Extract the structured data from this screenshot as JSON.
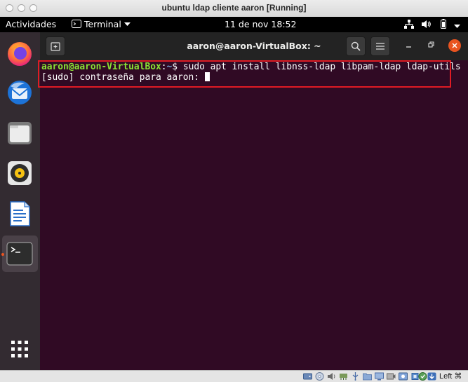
{
  "vbox": {
    "title": "ubuntu ldap cliente aaron [Running]",
    "host_key_label": "Left ⌘"
  },
  "topbar": {
    "activities": "Actividades",
    "app_menu": "Terminal",
    "clock": "11 de nov  18:52"
  },
  "terminal": {
    "title": "aaron@aaron-VirtualBox: ~",
    "prompt_user": "aaron@aaron-VirtualBox",
    "prompt_sep": ":",
    "prompt_path": "~",
    "prompt_symbol": "$ ",
    "command": "sudo apt install libnss-ldap libpam-ldap ldap-utils",
    "sudo_prompt": "[sudo] contraseña para aaron: "
  },
  "dock": {
    "apps": [
      "firefox",
      "thunderbird",
      "files",
      "rhythmbox",
      "libreoffice-writer",
      "terminal"
    ],
    "show_apps": "show-applications"
  },
  "colors": {
    "terminal_bg": "#300a24",
    "prompt_user": "#8ae234",
    "prompt_path": "#729fcf",
    "accent": "#e95420",
    "highlight_box": "#e01b24"
  }
}
